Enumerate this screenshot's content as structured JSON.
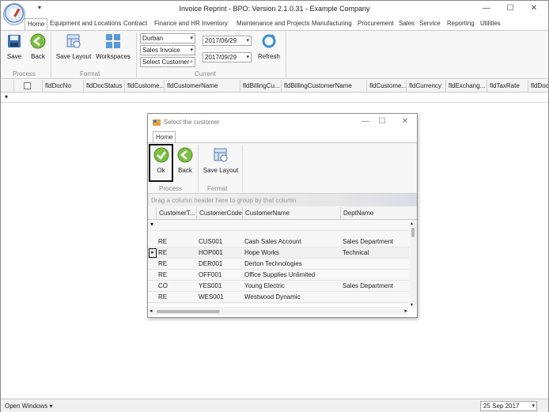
{
  "app": {
    "title": "Invoice Reprint - BPO: Version 2.1.0.31 - Example Company",
    "qat_arrow": "▾",
    "window_controls": {
      "minimize": "—",
      "maximize": "☐",
      "close": "✕"
    }
  },
  "tabs": [
    "Home",
    "Equipment and Locations",
    "Contract",
    "Finance and HR",
    "Inventory",
    "Maintenance and Projects",
    "Manufacturing",
    "Procurement",
    "Sales",
    "Service",
    "Reporting",
    "Utilities"
  ],
  "ribbon": {
    "save": "Save",
    "back": "Back",
    "save_layout": "Save Layout",
    "workspaces": "Workspaces",
    "group_process": "Process",
    "group_format": "Format",
    "group_current": "Current",
    "site_combo": "Durban",
    "doctype_combo": "Sales Invoice",
    "customer_select": "Select Customer",
    "date_from": "2017/06/29",
    "date_to": "2017/09/29",
    "refresh": "Refresh"
  },
  "grid": {
    "columns": [
      "fldDocNo",
      "fldDocStatus",
      "fldCustome...",
      "fldCustomerName",
      "fldBillingCu...",
      "fldBillingCustomerName",
      "fldCustome...",
      "fldCurrency",
      "fldExchang...",
      "fldTaxRate",
      "fldDocDa"
    ],
    "filter_icon": "▾"
  },
  "status": {
    "open_windows": "Open Windows",
    "date": "25 Sep 2017"
  },
  "dialog": {
    "title": "Select the customer",
    "tab": "Home",
    "ok": "Ok",
    "back": "Back",
    "save_layout": "Save Layout",
    "group_process": "Process",
    "group_format": "Format",
    "group_panel_hint": "Drag a column header here to group by that column",
    "columns": [
      "CustomerT...",
      "CustomerCode",
      "CustomerName",
      "DeptName"
    ],
    "filter_icon": "▾",
    "row_indicator": "▸",
    "rows": [
      {
        "type": "RE",
        "code": "CUS001",
        "name": "Cash Sales Account",
        "dept": "Sales Department"
      },
      {
        "type": "RE",
        "code": "HOP001",
        "name": "Hope Works",
        "dept": "Technical"
      },
      {
        "type": "RE",
        "code": "DER001",
        "name": "Derton Technologies",
        "dept": ""
      },
      {
        "type": "RE",
        "code": "OFF001",
        "name": "Office Supplies Unlimited",
        "dept": ""
      },
      {
        "type": "CO",
        "code": "YES001",
        "name": "Young Electric",
        "dept": "Sales Department"
      },
      {
        "type": "RE",
        "code": "WES001",
        "name": "Westwood Dynamic",
        "dept": ""
      }
    ]
  }
}
